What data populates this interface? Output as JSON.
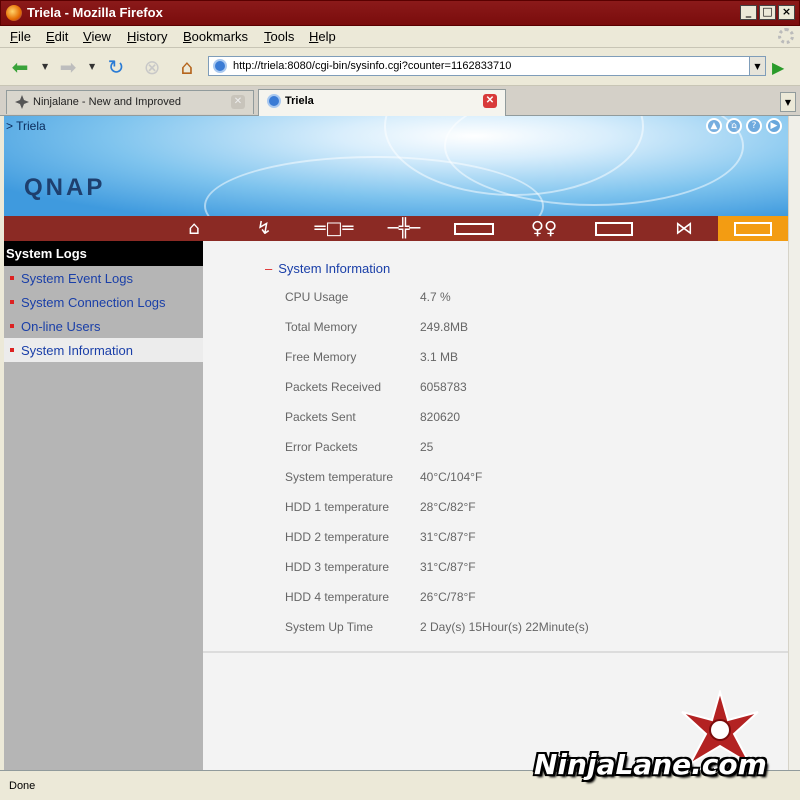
{
  "window": {
    "title": "Triela - Mozilla Firefox",
    "buttons": {
      "minimize": "_",
      "maximize": "□",
      "close": "×"
    }
  },
  "menu": {
    "items": [
      {
        "label": "File",
        "u": "F",
        "rest": "ile"
      },
      {
        "label": "Edit",
        "u": "E",
        "rest": "dit"
      },
      {
        "label": "View",
        "u": "V",
        "rest": "iew"
      },
      {
        "label": "History",
        "u": "H",
        "rest": "istory"
      },
      {
        "label": "Bookmarks",
        "u": "B",
        "rest": "ookmarks"
      },
      {
        "label": "Tools",
        "u": "T",
        "rest": "ools"
      },
      {
        "label": "Help",
        "u": "H",
        "rest": "elp"
      }
    ]
  },
  "nav": {
    "url": "http://triela:8080/cgi-bin/sysinfo.cgi?counter=1162833710",
    "icons": [
      "back-icon",
      "forward-icon",
      "reload-icon",
      "stop-icon",
      "home-icon",
      "go-icon"
    ]
  },
  "tabs": [
    {
      "label": "Ninjalane - New and Improved",
      "active": false
    },
    {
      "label": "Triela",
      "active": true
    }
  ],
  "page": {
    "breadcrumb": "> Triela",
    "logo": "QNAP",
    "sidebar": {
      "title": "System Logs",
      "items": [
        {
          "label": "System Event Logs",
          "selected": false
        },
        {
          "label": "System Connection Logs",
          "selected": false
        },
        {
          "label": "On-line Users",
          "selected": false
        },
        {
          "label": "System Information",
          "selected": true
        }
      ]
    },
    "main": {
      "section_title": "System Information",
      "rows": [
        {
          "label": "CPU Usage",
          "value": "4.7 %"
        },
        {
          "label": "Total Memory",
          "value": "249.8MB"
        },
        {
          "label": "Free Memory",
          "value": "3.1  MB"
        },
        {
          "label": "Packets Received",
          "value": "6058783"
        },
        {
          "label": "Packets Sent",
          "value": "820620"
        },
        {
          "label": "Error Packets",
          "value": "25"
        },
        {
          "label": "System temperature",
          "value": "40°C/104°F"
        },
        {
          "label": "HDD 1 temperature",
          "value": "28°C/82°F"
        },
        {
          "label": "HDD 2 temperature",
          "value": "31°C/87°F"
        },
        {
          "label": "HDD 3 temperature",
          "value": "31°C/87°F"
        },
        {
          "label": "HDD 4 temperature",
          "value": "26°C/78°F"
        },
        {
          "label": "System Up Time",
          "value": "2  Day(s)  15Hour(s) 22Minute(s)"
        }
      ]
    }
  },
  "status": "Done",
  "watermark": "NinjaLane.com",
  "colors": {
    "accent_red": "#8b2a24",
    "active_orange": "#f39c12",
    "link_blue": "#1a3fa8"
  }
}
